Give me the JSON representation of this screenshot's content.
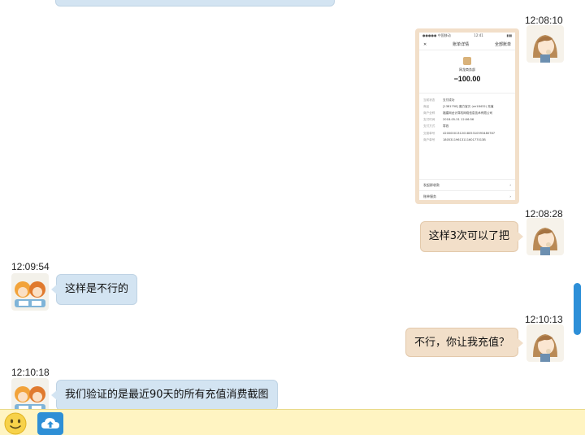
{
  "messages": {
    "m1": {
      "time": "12:08:10",
      "kind": "image"
    },
    "m2": {
      "time": "12:08:28",
      "text": "这样3次可以了把"
    },
    "m3": {
      "time": "12:09:54",
      "text": "这样是不行的"
    },
    "m4": {
      "time": "12:10:13",
      "text": "不行，你让我充值？"
    },
    "m5": {
      "time": "12:10:18",
      "text": "我们验证的是最近90天的所有充值消费截图"
    }
  },
  "receipt": {
    "status_left": "●●●●● 中国移动",
    "status_time": "12:41",
    "status_right": "▮▮▮",
    "nav_back": "✕",
    "nav_title": "账单详情",
    "nav_right": "全部账单",
    "merchant": "网龙商务部",
    "amount": "−100.00",
    "rows": [
      {
        "k": "当前状态",
        "v": "支付成功"
      },
      {
        "k": "商品",
        "v": "[1381758] 魔力宝贝 (wr18432) 充值"
      },
      {
        "k": "商户全称",
        "v": "福建网龙计算机网络信息技术有限公司"
      },
      {
        "k": "支付时间",
        "v": "2018-05-31 12:06:56"
      },
      {
        "k": "支付方式",
        "v": "零钱"
      },
      {
        "k": "交易单号",
        "v": "4200000131201805310593480787"
      },
      {
        "k": "商户单号",
        "v": "1805311961311160177013B"
      }
    ],
    "foot1": "发起群收款",
    "foot2": "账单服务",
    "chevron": "›"
  },
  "colors": {
    "left_bubble": "#d3e4f2",
    "right_bubble": "#f2dfc9",
    "bottom_bar": "#fff4c2",
    "scrollbar": "#2d8fd8",
    "upload_button": "#2e8fd6"
  },
  "icons": {
    "emoji": "smiley-icon",
    "upload": "cloud-upload-icon"
  }
}
